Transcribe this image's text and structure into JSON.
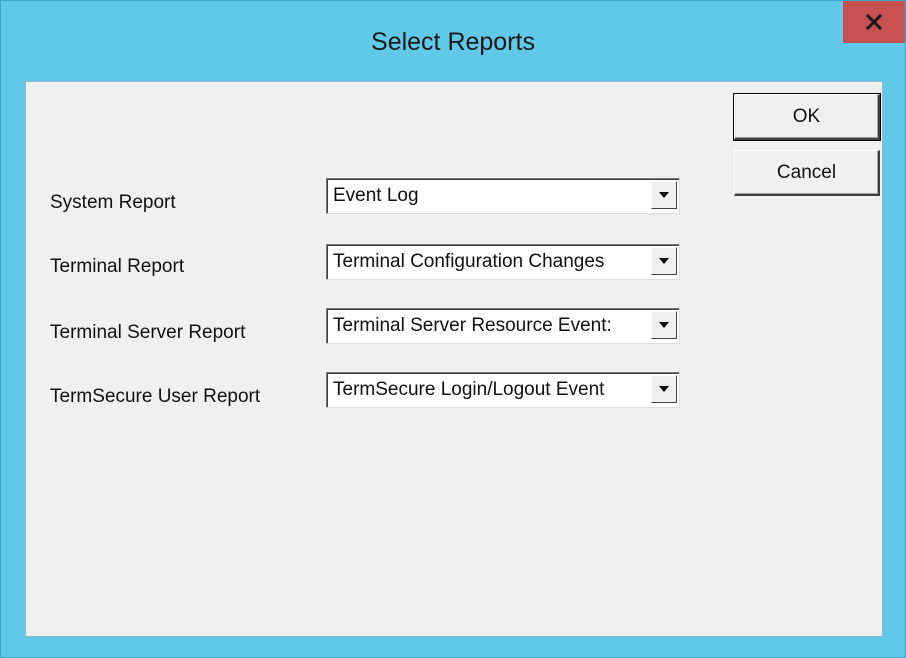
{
  "window": {
    "title": "Select Reports",
    "close_label": "x"
  },
  "rows": [
    {
      "label": "System Report",
      "value": "Event Log"
    },
    {
      "label": "Terminal Report",
      "value": "Terminal Configuration Changes"
    },
    {
      "label": "Terminal Server Report",
      "value": "Terminal Server Resource Event:"
    },
    {
      "label": "TermSecure User Report",
      "value": "TermSecure Login/Logout Event"
    }
  ],
  "buttons": {
    "ok_label": "OK",
    "cancel_label": "Cancel"
  },
  "icons": {
    "close": "close-icon",
    "dropdown": "chevron-down-icon"
  },
  "colors": {
    "titlebar": "#62c8e8",
    "close_button": "#c75050",
    "client_background": "#f0f0f0"
  }
}
